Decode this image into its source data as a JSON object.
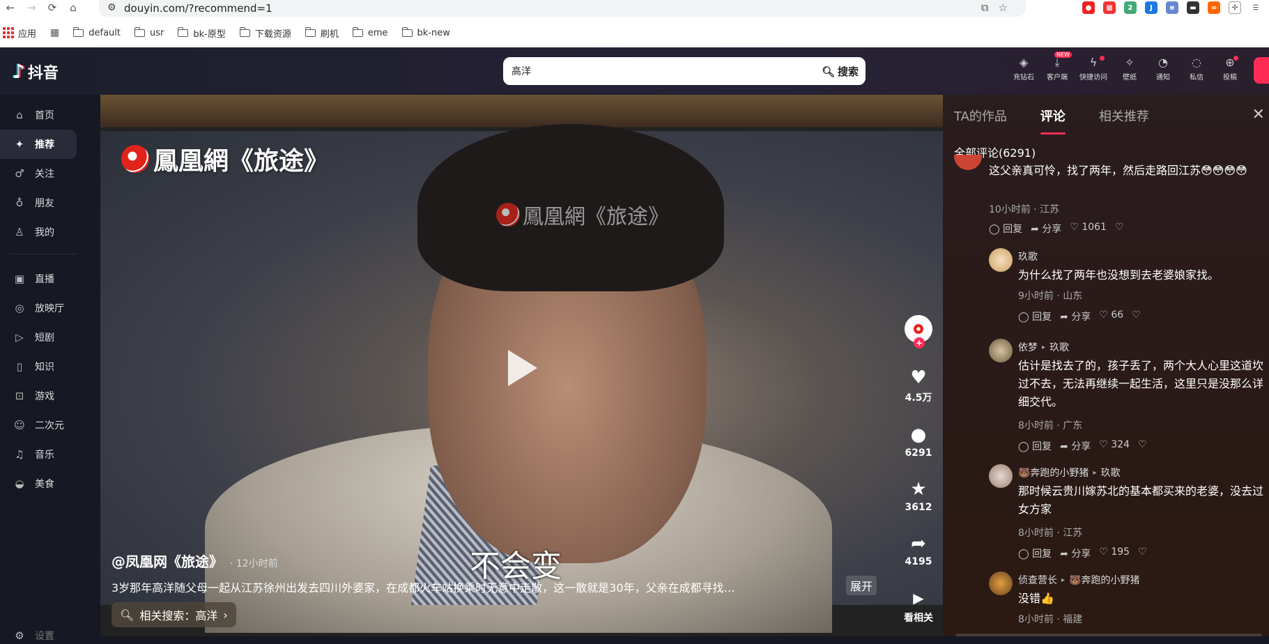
{
  "browser": {
    "url": "douyin.com/?recommend=1",
    "bookmarks": [
      "应用",
      "default",
      "usr",
      "bk-原型",
      "下载资源",
      "刷机",
      "eme",
      "bk-new"
    ]
  },
  "header": {
    "logo_text": "抖音",
    "search_value": "高洋",
    "search_button": "搜索",
    "icons": [
      {
        "label": "充钻石",
        "icon": "diamond-icon"
      },
      {
        "label": "客户端",
        "icon": "download-icon",
        "badge": "NEW"
      },
      {
        "label": "快捷访问",
        "icon": "lightning-icon"
      },
      {
        "label": "壁纸",
        "icon": "pin-icon"
      },
      {
        "label": "通知",
        "icon": "bell-icon"
      },
      {
        "label": "私信",
        "icon": "message-icon"
      },
      {
        "label": "投稿",
        "icon": "upload-icon"
      }
    ]
  },
  "sidebar": {
    "items": [
      {
        "label": "首页",
        "icon": "home-icon"
      },
      {
        "label": "推荐",
        "icon": "sparkle-icon",
        "active": true
      },
      {
        "label": "关注",
        "icon": "follow-icon"
      },
      {
        "label": "朋友",
        "icon": "friends-icon"
      },
      {
        "label": "我的",
        "icon": "user-icon"
      }
    ],
    "items2": [
      {
        "label": "直播",
        "icon": "tv-icon"
      },
      {
        "label": "放映厅",
        "icon": "film-icon"
      },
      {
        "label": "短剧",
        "icon": "play-circle-icon"
      },
      {
        "label": "知识",
        "icon": "book-icon"
      },
      {
        "label": "游戏",
        "icon": "gamepad-icon"
      },
      {
        "label": "二次元",
        "icon": "ghost-icon"
      },
      {
        "label": "音乐",
        "icon": "music-icon"
      },
      {
        "label": "美食",
        "icon": "food-icon"
      }
    ],
    "settings": "设置"
  },
  "video": {
    "watermark": "鳳凰網《旅途》",
    "subtitle": "不会变",
    "author": "@凤凰网《旅途》",
    "time": "· 12小时前",
    "description": "3岁那年高洋随父母一起从江苏徐州出发去四川外婆家，在成都火车站换乘时无意中走散，这一散就是30年，父亲在成都寻找…",
    "expand": "展开",
    "related_search": "相关搜索：高洋",
    "likes": "4.5万",
    "comments": "6291",
    "favorites": "3612",
    "shares": "4195",
    "see_related": "看相关"
  },
  "panel": {
    "tabs": [
      "TA的作品",
      "评论",
      "相关推荐"
    ],
    "total": "全部评论(6291)",
    "comments": [
      {
        "text": "这父亲真可怜，找了两年，然后走路回江苏😳😳😳😳",
        "meta": "10小时前 · 江苏",
        "reply": "回复",
        "share": "分享",
        "likes": "1061"
      },
      {
        "user": "玖歌",
        "text": "为什么找了两年也没想到去老婆娘家找。",
        "meta": "9小时前 · 山东",
        "reply": "回复",
        "share": "分享",
        "likes": "66"
      },
      {
        "user": "依梦",
        "reply_to": "玖歌",
        "text": "估计是找去了的，孩子丢了，两个大人心里这道坎过不去，无法再继续一起生活，这里只是没那么详细交代。",
        "meta": "8小时前 · 广东",
        "reply": "回复",
        "share": "分享",
        "likes": "324"
      },
      {
        "user": "🐻奔跑的小野猪",
        "reply_to": "玖歌",
        "text": "那时候云贵川嫁苏北的基本都买来的老婆，没去过女方家",
        "meta": "8小时前 · 江苏",
        "reply": "回复",
        "share": "分享",
        "likes": "195"
      },
      {
        "user": "侦查营长",
        "reply_to": "🐻奔跑的小野猪",
        "text": "没错👍",
        "meta": "8小时前 · 福建"
      }
    ]
  }
}
